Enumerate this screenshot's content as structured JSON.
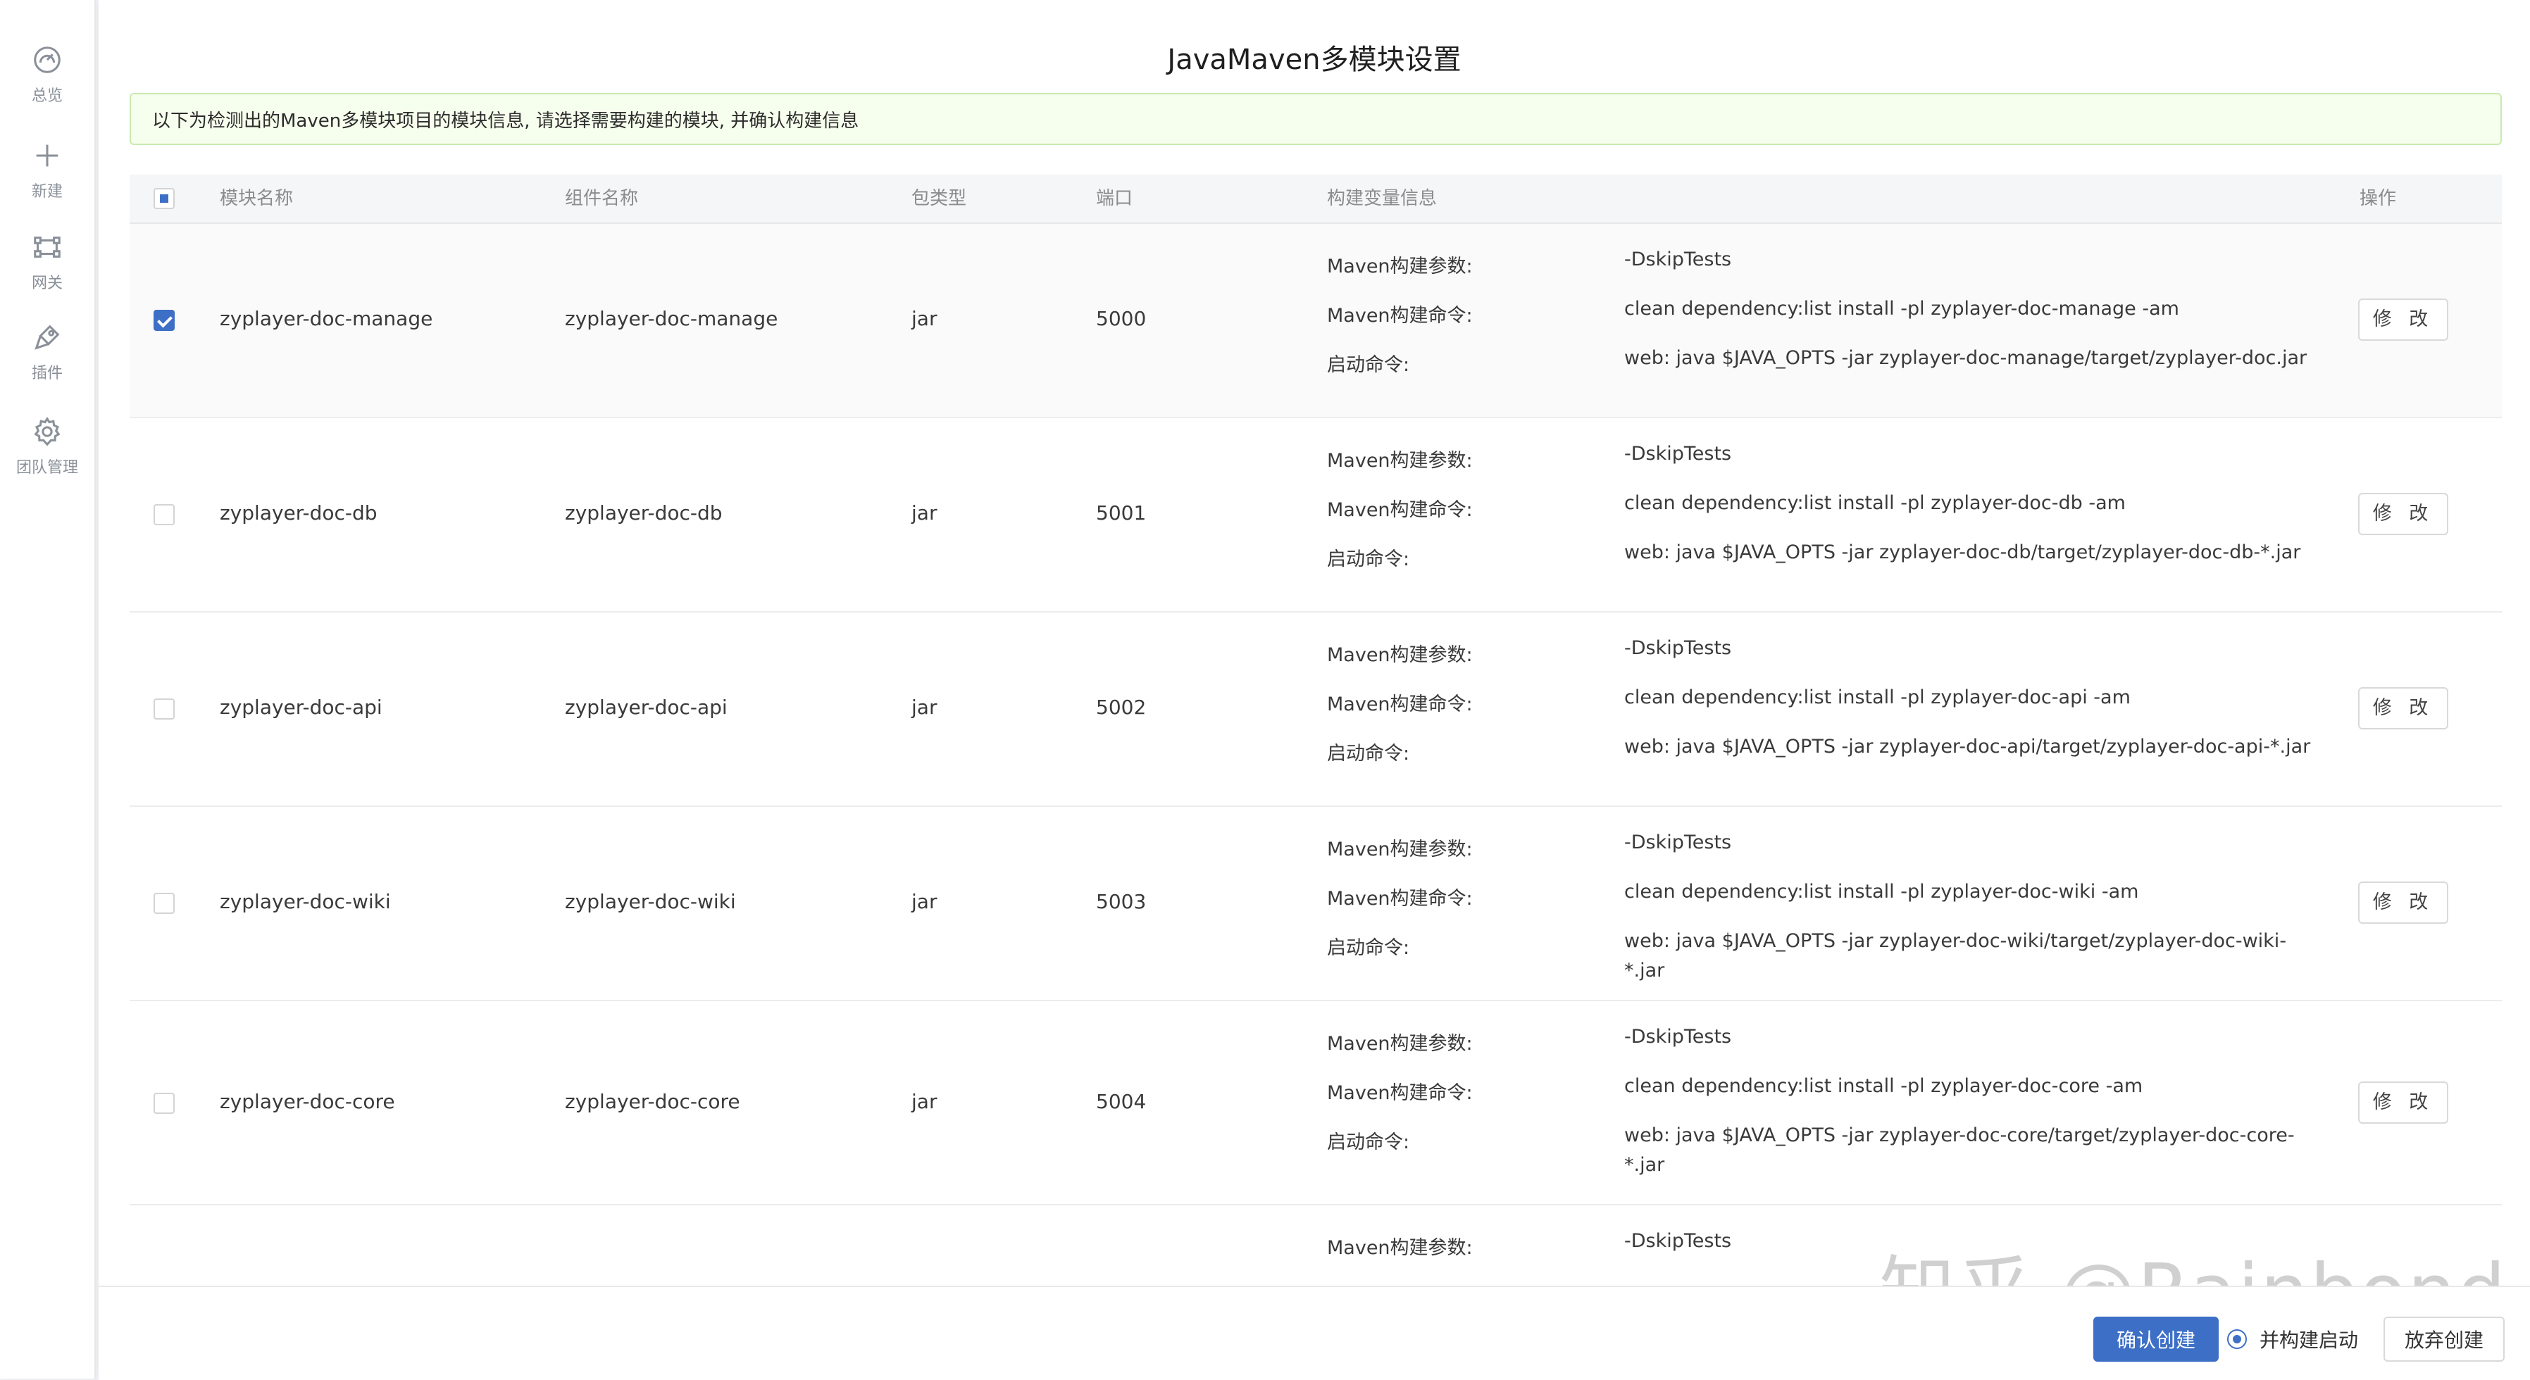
{
  "sidebar": {
    "items": [
      {
        "label": "总览",
        "icon": "dashboard-icon"
      },
      {
        "label": "新建",
        "icon": "plus-icon"
      },
      {
        "label": "网关",
        "icon": "gateway-icon"
      },
      {
        "label": "插件",
        "icon": "plugin-icon"
      },
      {
        "label": "团队管理",
        "icon": "gear-icon"
      }
    ]
  },
  "page": {
    "title": "JavaMaven多模块设置",
    "notice": "以下为检测出的Maven多模块项目的模块信息, 请选择需要构建的模块, 并确认构建信息"
  },
  "table": {
    "headers": {
      "module_name": "模块名称",
      "component_name": "组件名称",
      "package_type": "包类型",
      "port": "端口",
      "build_vars": "构建变量信息",
      "actions": "操作"
    },
    "var_labels": {
      "params": "Maven构建参数:",
      "command": "Maven构建命令:",
      "start": "启动命令:"
    },
    "edit_label": "修 改",
    "rows": [
      {
        "module": "zyplayer-doc-manage",
        "component": "zyplayer-doc-manage",
        "type": "jar",
        "port": "5000",
        "params": "-DskipTests",
        "command": "clean dependency:list install -pl zyplayer-doc-manage -am",
        "start": "web: java $JAVA_OPTS -jar zyplayer-doc-manage/target/zyplayer-doc.jar",
        "checked": true
      },
      {
        "module": "zyplayer-doc-db",
        "component": "zyplayer-doc-db",
        "type": "jar",
        "port": "5001",
        "params": "-DskipTests",
        "command": "clean dependency:list install -pl zyplayer-doc-db -am",
        "start": "web: java $JAVA_OPTS -jar zyplayer-doc-db/target/zyplayer-doc-db-*.jar",
        "checked": false
      },
      {
        "module": "zyplayer-doc-api",
        "component": "zyplayer-doc-api",
        "type": "jar",
        "port": "5002",
        "params": "-DskipTests",
        "command": "clean dependency:list install -pl zyplayer-doc-api -am",
        "start": "web: java $JAVA_OPTS -jar zyplayer-doc-api/target/zyplayer-doc-api-*.jar",
        "checked": false
      },
      {
        "module": "zyplayer-doc-wiki",
        "component": "zyplayer-doc-wiki",
        "type": "jar",
        "port": "5003",
        "params": "-DskipTests",
        "command": "clean dependency:list install -pl zyplayer-doc-wiki -am",
        "start": "web: java $JAVA_OPTS -jar zyplayer-doc-wiki/target/zyplayer-doc-wiki-*.jar",
        "checked": false
      },
      {
        "module": "zyplayer-doc-core",
        "component": "zyplayer-doc-core",
        "type": "jar",
        "port": "5004",
        "params": "-DskipTests",
        "command": "clean dependency:list install -pl zyplayer-doc-core -am",
        "start": "web: java $JAVA_OPTS -jar zyplayer-doc-core/target/zyplayer-doc-core-*.jar",
        "checked": false
      },
      {
        "params": "-DskipTests"
      }
    ]
  },
  "footer": {
    "confirm_label": "确认创建",
    "radio_label": "并构建启动",
    "discard_label": "放弃创建"
  },
  "watermark": "知乎 @Rainbond",
  "colors": {
    "primary": "#3d6fc6",
    "notice_bg": "#f6ffed",
    "notice_border": "#c9eab0"
  }
}
